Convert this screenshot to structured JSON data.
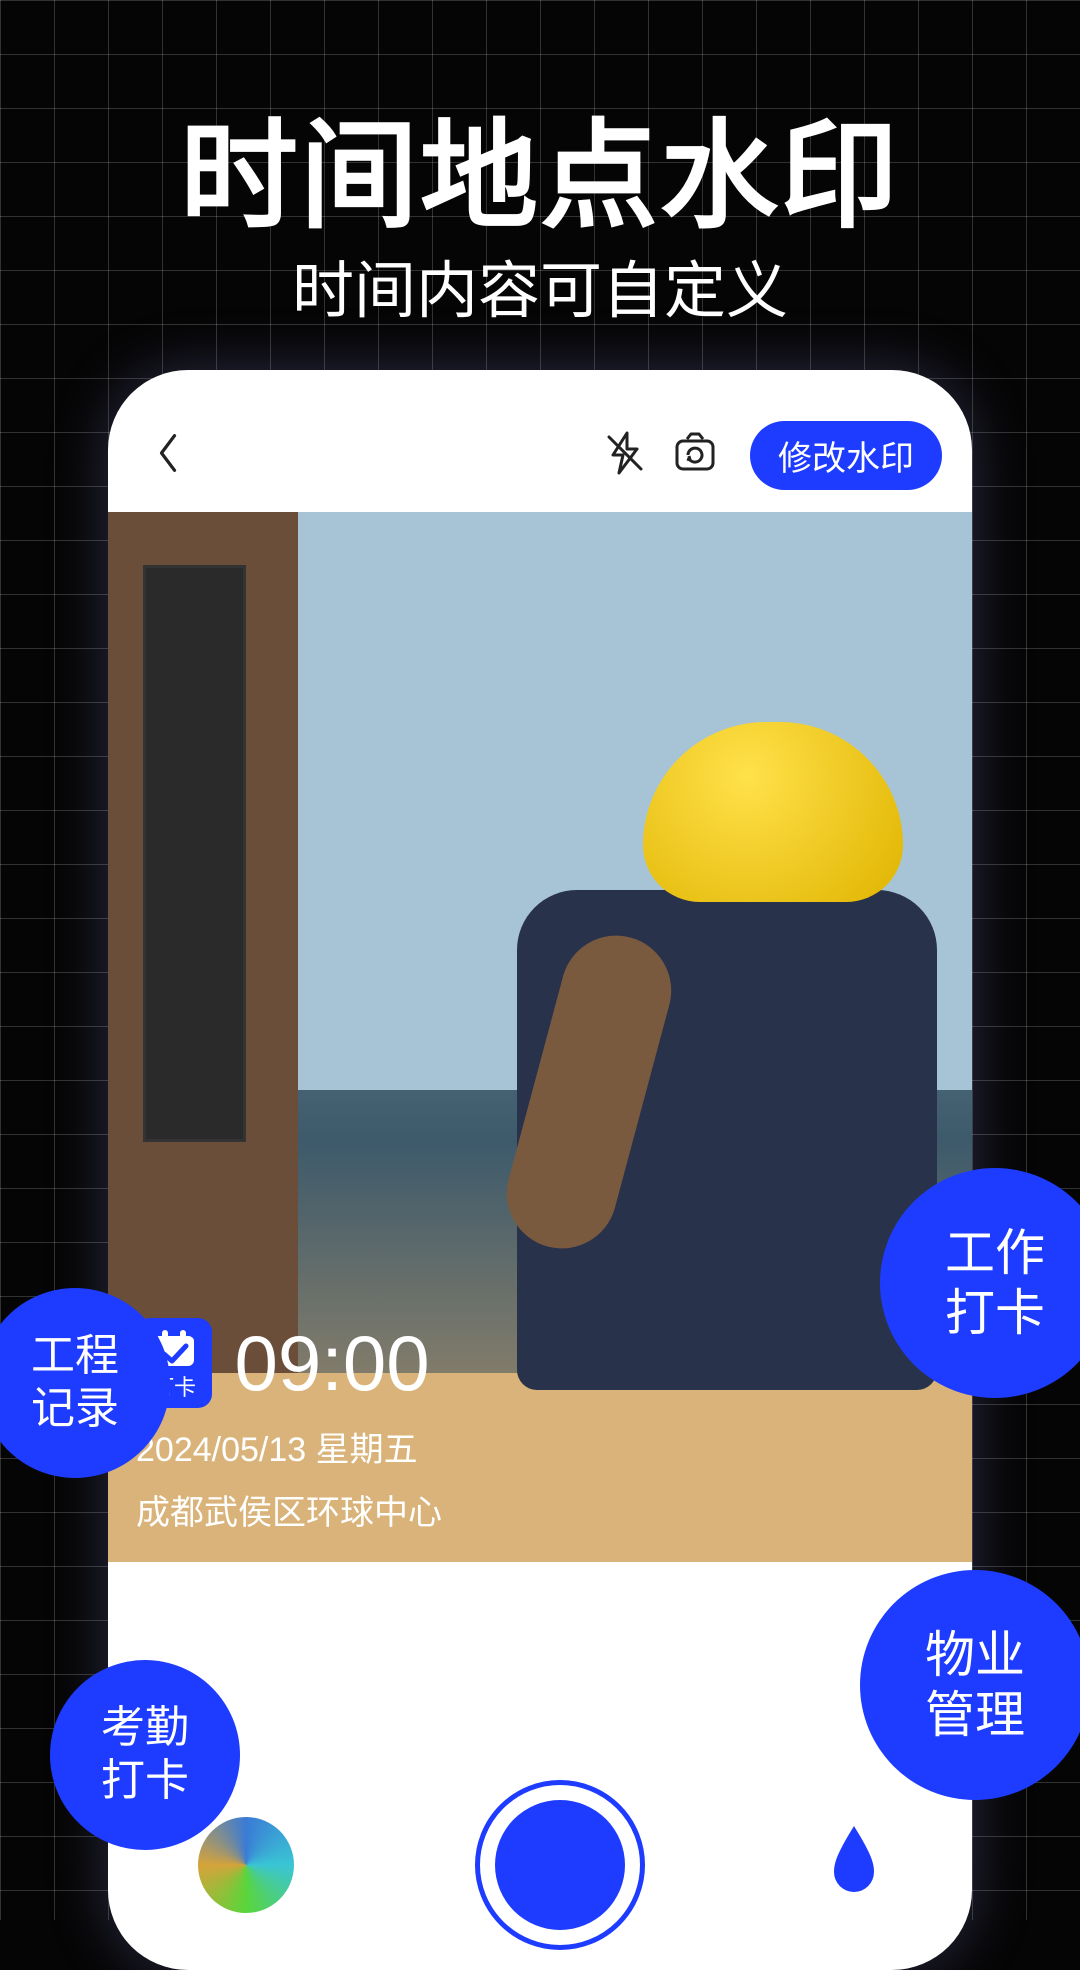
{
  "promo": {
    "headline": "时间地点水印",
    "subhead": "时间内容可自定义"
  },
  "header": {
    "edit_watermark_label": "修改水印"
  },
  "watermark": {
    "badge_label": "打卡",
    "time": "09:00",
    "date_line": "2024/05/13  星期五",
    "location": "成都武侯区环球中心"
  },
  "bubbles": {
    "top_right": "工作\n打卡",
    "mid_left": "工程\n记录",
    "bottom_right": "物业\n管理",
    "bottom_left": "考勤\n打卡"
  },
  "colors": {
    "accent": "#1E3CFF"
  }
}
